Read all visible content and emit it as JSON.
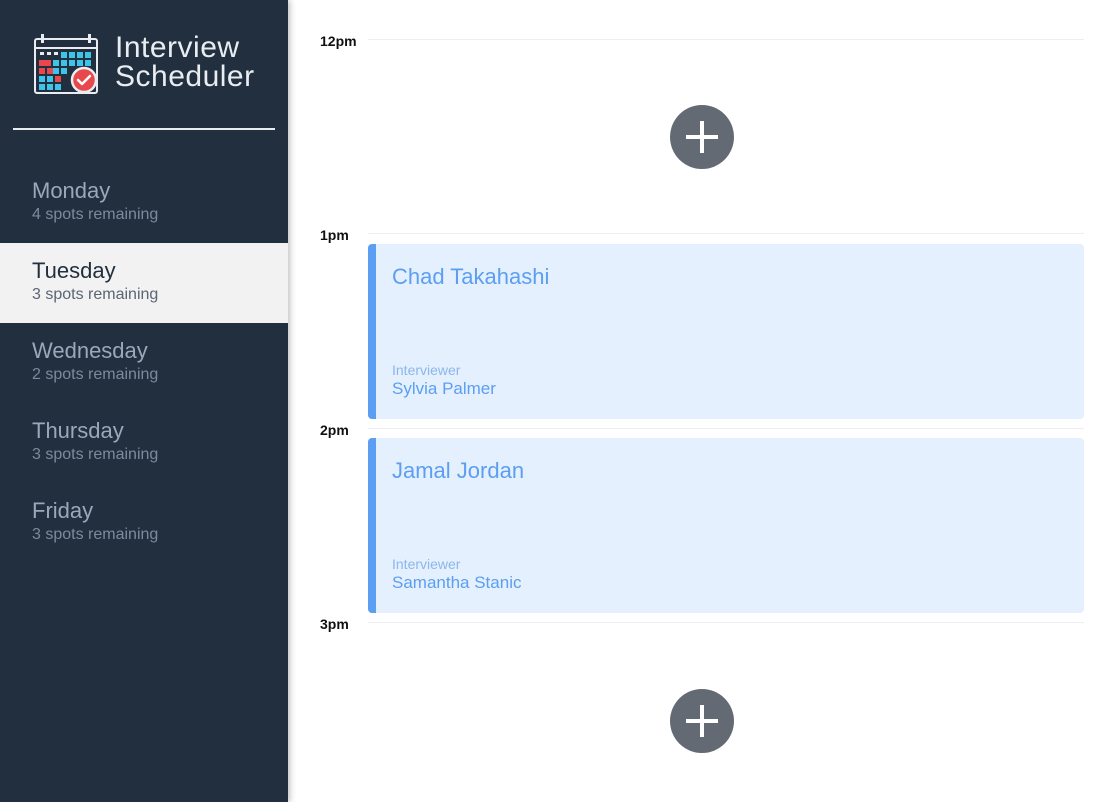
{
  "brand": {
    "title_line1": "Interview",
    "title_line2": "Scheduler",
    "logo_icon": "calendar-check-icon"
  },
  "days": [
    {
      "name": "Monday",
      "spots": "4 spots remaining",
      "selected": false
    },
    {
      "name": "Tuesday",
      "spots": "3 spots remaining",
      "selected": true
    },
    {
      "name": "Wednesday",
      "spots": "2 spots remaining",
      "selected": false
    },
    {
      "name": "Thursday",
      "spots": "3 spots remaining",
      "selected": false
    },
    {
      "name": "Friday",
      "spots": "3 spots remaining",
      "selected": false
    }
  ],
  "schedule": {
    "times": [
      "12pm",
      "1pm",
      "2pm",
      "3pm"
    ],
    "add_icon": "plus-icon",
    "appointments": [
      {
        "student": "Chad Takahashi",
        "interviewer_label": "Interviewer",
        "interviewer": "Sylvia Palmer"
      },
      {
        "student": "Jamal Jordan",
        "interviewer_label": "Interviewer",
        "interviewer": "Samantha Stanic"
      }
    ]
  },
  "colors": {
    "sidebar_bg": "#222f3e",
    "accent_blue": "#5b9ef2",
    "appointment_bg": "#e4f0fd",
    "add_button": "#646a73"
  }
}
